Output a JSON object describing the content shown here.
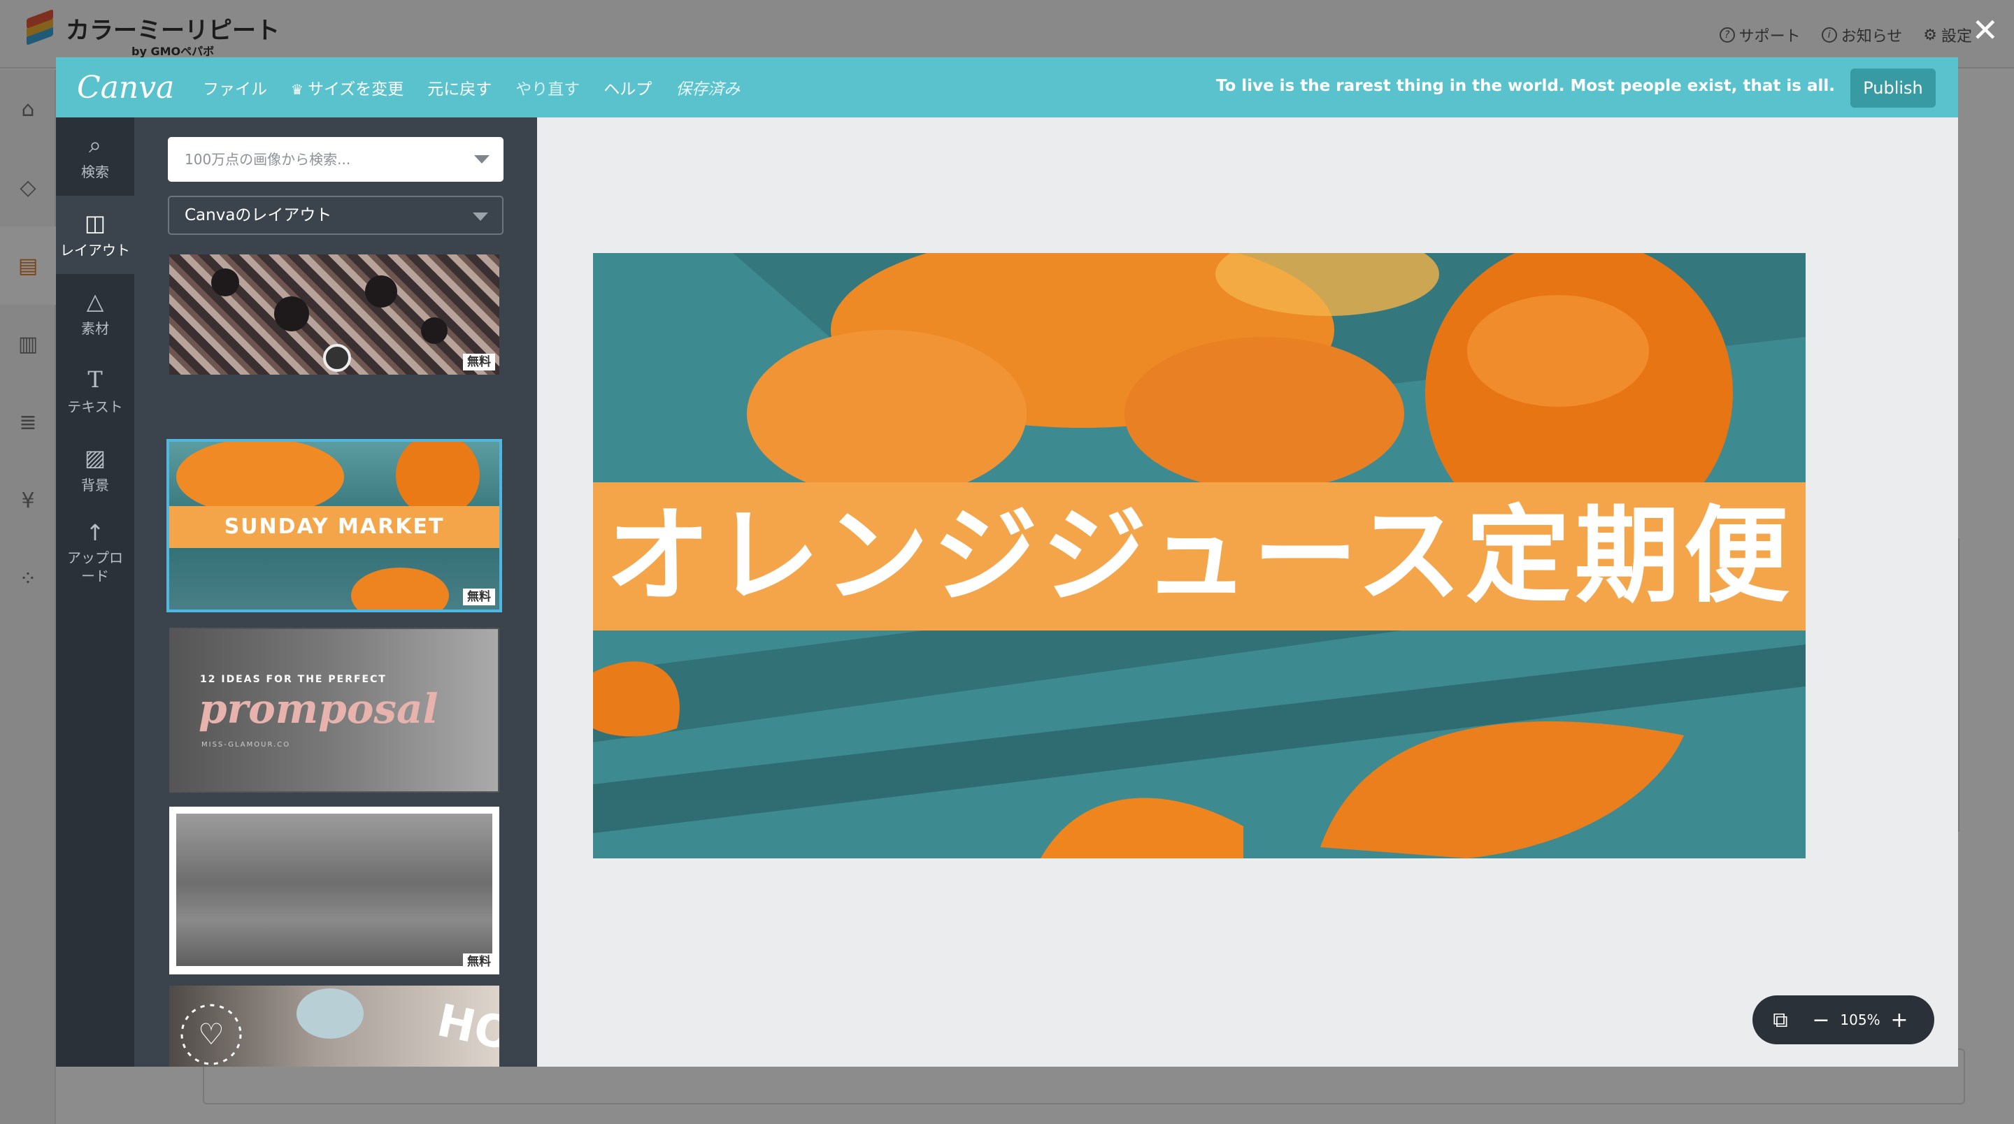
{
  "app": {
    "brand_title": "カラーミーリピート",
    "brand_by": "by GMOペパボ",
    "links": [
      {
        "icon": "question-icon",
        "label": "サポート"
      },
      {
        "icon": "info-icon",
        "label": "お知らせ"
      },
      {
        "icon": "gear-icon",
        "label": "設定"
      }
    ]
  },
  "canva": {
    "logo": "Canva",
    "menu": {
      "file": "ファイル",
      "resize": "サイズを変更",
      "undo": "元に戻す",
      "redo": "やり直す",
      "help": "ヘルプ",
      "saved": "保存済み"
    },
    "tagline": "To live is the rarest thing in the world. Most people exist, that is all.",
    "publish": "Publish",
    "tools": [
      {
        "icon": "search-icon",
        "label": "検索"
      },
      {
        "icon": "layout-icon",
        "label": "レイアウト"
      },
      {
        "icon": "elements-icon",
        "label": "素材"
      },
      {
        "icon": "text-icon",
        "label": "テキスト"
      },
      {
        "icon": "background-icon",
        "label": "背景"
      },
      {
        "icon": "upload-icon",
        "label": "アップロード"
      }
    ],
    "search_placeholder": "100万点の画像から検索...",
    "layout_select": "Canvaのレイアウト",
    "thumbnails": {
      "free_badge": "無料",
      "sunday": "SUNDAY MARKET",
      "promposal_small": "12 IDEAS FOR THE PERFECT",
      "promposal_big": "promposal",
      "promposal_site": "MISS-GLAMOUR.CO"
    },
    "design_text": "オレンジジュース定期便",
    "zoom_level": "105%",
    "colors": {
      "topbar": "#5ac2cc",
      "banner": "#f4a54a",
      "rail": "#2b3138"
    }
  }
}
